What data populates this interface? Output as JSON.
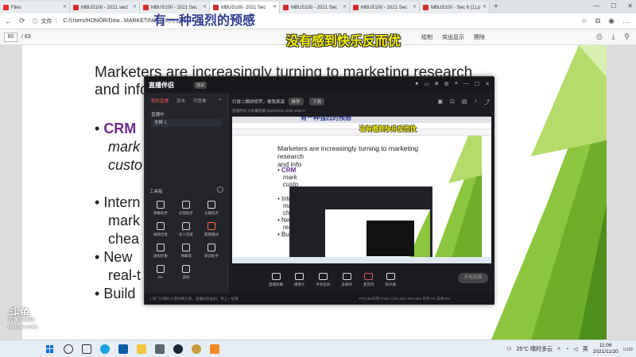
{
  "browser": {
    "tabs": [
      {
        "label": "Files",
        "active": false
      },
      {
        "label": "MBUS100 - 2021 sect",
        "active": false
      },
      {
        "label": "MBUS100 - 2021 Sec",
        "active": false
      },
      {
        "label": "MBUS100- 2021 Sec",
        "active": true
      },
      {
        "label": "MBUS100 - 2021 Sec",
        "active": false
      },
      {
        "label": "MBUS100 - 2021 Sec",
        "active": false
      },
      {
        "label": "MBUS100 - Sec 6 (1).p",
        "active": false
      }
    ],
    "address_label": "文件",
    "url": "C:/Users/HONOR/Dow...MARKETING%20(6).pdf"
  },
  "pdf_toolbar": {
    "page_current": "60",
    "page_total": "/ 63",
    "tools": [
      "绘制",
      "突出显示",
      "擦除"
    ]
  },
  "overlay": {
    "danmaku_top": "有一种强烈的预感",
    "danmaku_mid": "没有感到快乐反而优"
  },
  "slide": {
    "title_line1": "Marketers are increasingly turning to marketing research",
    "title_line2": "and info",
    "bullet1_crm": "CRM",
    "bullet1_line2": "mark",
    "bullet1_line3": "custo",
    "bullet2_line1": "Intern",
    "bullet2_line2": "mark",
    "bullet2_line3": "chea",
    "bullet3_line1": "New",
    "bullet3_line2": "real-t",
    "bullet4": "Build"
  },
  "streamer_app": {
    "title": "直播伴侣",
    "version": "测试",
    "side_tabs": [
      "我的直播",
      "双击",
      "可查看"
    ],
    "side_items": [
      "直播中",
      "全屏 1"
    ],
    "tools_header": "工具箱",
    "tools": [
      "弹幕助手",
      "房管助手",
      "主播任务",
      "视频连麦",
      "多人连麦",
      "超管模式",
      "虚拟形象",
      "弹幕墙",
      "歌词助手",
      "PK",
      "游戏"
    ],
    "stream_title": "打游二模拼修罗，看我表演",
    "stream_tag": "推荐",
    "stream_pill": "下面",
    "stream_meta": "直播时间  大屏幕直播  2020/10/11  1025   1920  0",
    "controls": [
      "直播屏幕",
      "摄像头",
      "手机投屏",
      "多媒体",
      "麦克风",
      "扬声器"
    ],
    "go_live": "开始直播",
    "footer_note": "1.热门小喇叭大家好刷礼物，直播间有福利，更上一层楼",
    "footer_stats": "FPS:30  码率:0 kb/s  CPU:15%  GPU:8%  内存:7%  丢帧:0%"
  },
  "preview": {
    "title_line1": "Marketers are increasingly turning to marketing research",
    "title_line2": "and info",
    "bullets": [
      "CRM",
      "mark",
      "custo",
      "Intern",
      "mark",
      "chea",
      "New",
      "real-t",
      "Build"
    ]
  },
  "watermark": {
    "line1": "斗鱼",
    "line2": "斗鱼88888",
    "line3": "douyu.com"
  },
  "taskbar": {
    "weather": "25°C 晴时多云",
    "lang": "英",
    "time": "11:06",
    "date": "2021/11/20",
    "notif": "22"
  },
  "colors": {
    "crm_purple": "#6a2c8f",
    "slide_green": "#8cc63f",
    "danmaku_blue": "#2e3a8c",
    "danmaku_yellow": "#f3f000",
    "app_bg": "#1f2127"
  }
}
